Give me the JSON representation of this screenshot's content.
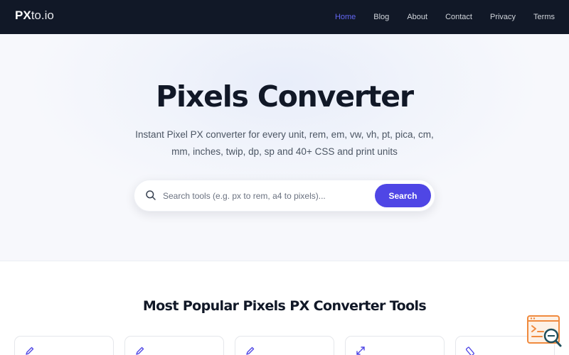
{
  "header": {
    "logo_strong": "PX",
    "logo_light": "to.io",
    "nav": [
      {
        "label": "Home",
        "active": true
      },
      {
        "label": "Blog",
        "active": false
      },
      {
        "label": "About",
        "active": false
      },
      {
        "label": "Contact",
        "active": false
      },
      {
        "label": "Privacy",
        "active": false
      },
      {
        "label": "Terms",
        "active": false
      }
    ]
  },
  "hero": {
    "title": "Pixels Converter",
    "subtitle": "Instant Pixel PX converter for every unit, rem, em, vw, vh, pt, pica, cm, mm, inches, twip, dp, sp and 40+ CSS and print units"
  },
  "search": {
    "placeholder": "Search tools (e.g. px to rem, a4 to pixels)...",
    "value": "",
    "button_label": "Search",
    "icon": "search-icon"
  },
  "popular": {
    "title": "Most Popular Pixels PX Converter Tools",
    "cards": [
      {
        "icon": "pencil-icon"
      },
      {
        "icon": "pencil-icon"
      },
      {
        "icon": "pencil-icon"
      },
      {
        "icon": "expand-arrows-icon"
      },
      {
        "icon": "ruler-icon"
      }
    ]
  },
  "widget": {
    "icon": "code-search-icon"
  },
  "colors": {
    "header_bg": "#111827",
    "nav_text": "#d1d5db",
    "nav_active": "#6366f1",
    "accent": "#4f46e5",
    "title_text": "#111827",
    "body_text": "#4b5563",
    "widget_orange": "#f08a3e",
    "widget_teal": "#1f4f5c"
  }
}
